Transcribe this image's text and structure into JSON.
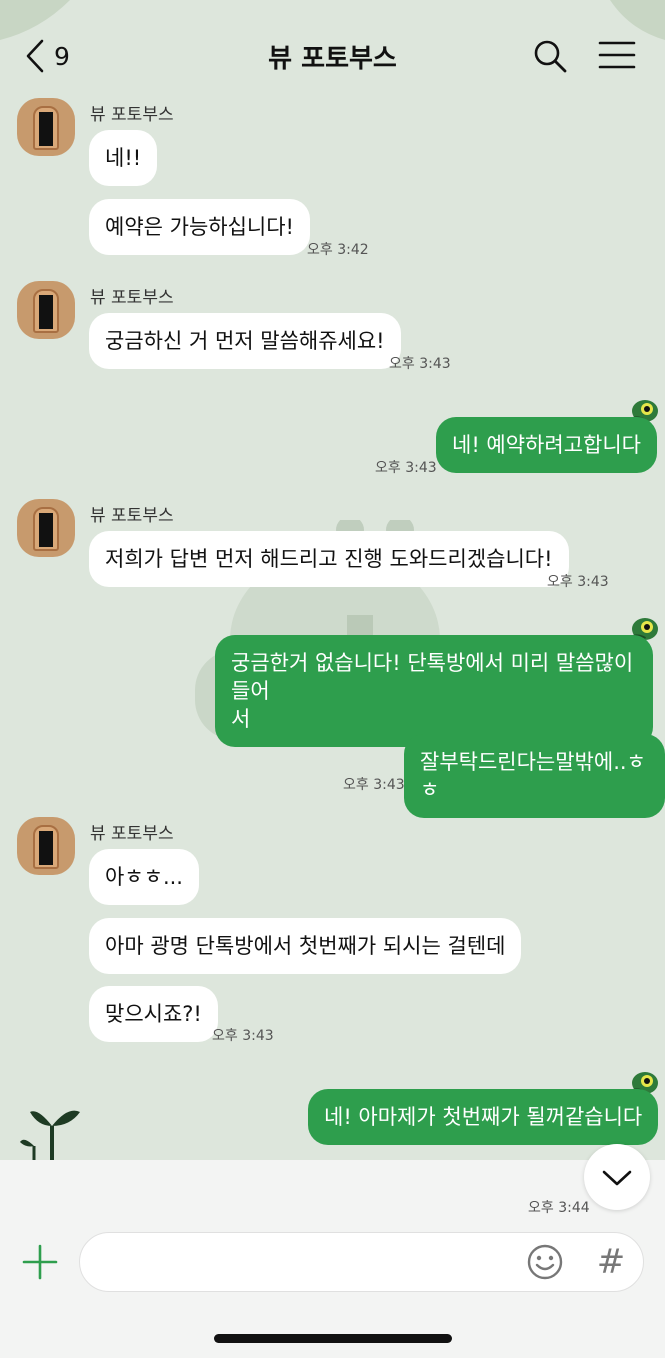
{
  "header": {
    "back_count": "9",
    "title": "뷰 포토부스",
    "icons": [
      "chevron-left-icon",
      "search-icon",
      "menu-icon"
    ]
  },
  "messages": [
    {
      "sender": "뷰 포토부스",
      "bubbles": [
        "네!!",
        "예약은 가능하십니다!"
      ],
      "time": "오후 3:42"
    },
    {
      "sender": "뷰 포토부스",
      "bubbles": [
        "궁금하신 거 먼저 말씀해쥬세요!"
      ],
      "time": "오후 3:43"
    },
    {
      "me": true,
      "bubbles": [
        "네! 예약하려고합니다"
      ],
      "time": "오후 3:43"
    },
    {
      "sender": "뷰 포토부스",
      "bubbles": [
        "저희가 답변 먼저 해드리고 진행 도와드리겠습니다!"
      ],
      "time": "오후 3:43"
    },
    {
      "me": true,
      "bubbles": [
        "궁금한거 없습니다! 단톡방에서 미리 말씀많이들어\n서",
        "잘부탁드린다는말밖에..ㅎㅎ"
      ],
      "time": "오후 3:43"
    },
    {
      "sender": "뷰 포토부스",
      "bubbles": [
        "아ㅎㅎ...",
        "아마 광명 단톡방에서 첫번째가 되시는 걸텐데",
        "맞으시죠?!"
      ],
      "time": "오후 3:43"
    },
    {
      "me": true,
      "bubbles": [
        "네! 아마제가 첫번째가 될꺼같습니다"
      ],
      "time": "오후 3:44"
    }
  ],
  "composer": {
    "icons": [
      "plus-icon",
      "emoji-icon",
      "hashtag-icon"
    ],
    "hash_glyph": "#"
  },
  "colors": {
    "background": "#dde6dc",
    "sent_bubble": "#2e9e4d",
    "received_bubble": "#ffffff",
    "accent": "#2e9e4d"
  }
}
